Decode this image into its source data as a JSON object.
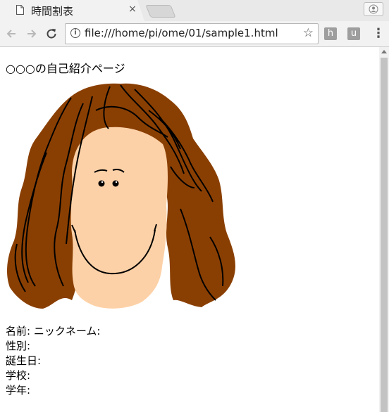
{
  "browser": {
    "tab_title": "時間割表",
    "tab_close": "×",
    "url": "file:///home/pi/ome/01/sample1.html",
    "extensions": [
      "h",
      "u"
    ],
    "icons": {
      "back": "back-arrow-icon",
      "forward": "forward-arrow-icon",
      "reload": "reload-icon",
      "info": "info-icon",
      "bookmark": "star-icon",
      "menu": "more-vert-icon",
      "profile": "profile-icon"
    }
  },
  "page": {
    "heading": "○○○の自己紹介ページ",
    "fields": [
      "名前: ニックネーム:",
      "性別:",
      "誕生日:",
      "学校:",
      "学年:"
    ]
  },
  "colors": {
    "hair": "#8a3f02",
    "skin": "#fdd1a7",
    "line": "#000000"
  }
}
